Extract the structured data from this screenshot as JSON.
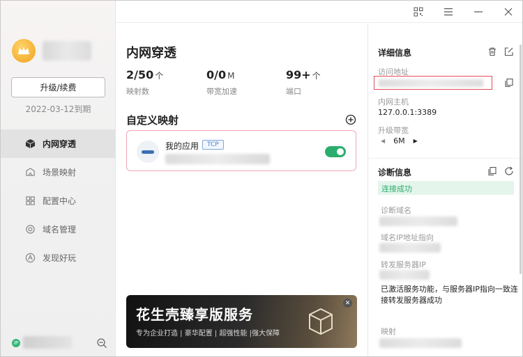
{
  "sidebar": {
    "upgrade_label": "升级/续费",
    "expire_text": "2022-03-12到期",
    "items": [
      {
        "label": "内网穿透",
        "icon": "cube-icon",
        "active": true
      },
      {
        "label": "场景映射",
        "icon": "scene-icon",
        "active": false
      },
      {
        "label": "配置中心",
        "icon": "config-icon",
        "active": false
      },
      {
        "label": "域名管理",
        "icon": "domain-icon",
        "active": false
      },
      {
        "label": "发现好玩",
        "icon": "discover-icon",
        "active": false
      }
    ],
    "ip_badge": "IP"
  },
  "main": {
    "title": "内网穿透",
    "stats": [
      {
        "value": "2/50",
        "unit": "个",
        "label": "映射数"
      },
      {
        "value": "0/0",
        "unit": "M",
        "label": "带宽加速"
      },
      {
        "value": "99+",
        "unit": "个",
        "label": "端口"
      }
    ],
    "custom_section_title": "自定义映射",
    "mapping": {
      "name": "我的应用",
      "protocol": "TCP",
      "enabled": true
    },
    "banner": {
      "title": "花生壳臻享版服务",
      "subtitle": "专为企业打造 | 豪华配置 | 超强性能 |强大保障",
      "close": "✕"
    }
  },
  "detail": {
    "title": "详细信息",
    "access_label": "访问地址",
    "host_label": "内网主机",
    "host_value": "127.0.0.1:3389",
    "bandwidth_label": "升级带宽",
    "bandwidth_value": "6M"
  },
  "diagnosis": {
    "title": "诊断信息",
    "status": "连接成功",
    "domain_label": "诊断域名",
    "ip_label": "域名IP地址指向",
    "server_label": "转发服务器IP",
    "note": "已激活服务功能，与服务器IP指向一致连接转发服务器成功",
    "mapping_label": "映射"
  },
  "colors": {
    "accent_green": "#2bad6d",
    "alert_red": "#e34c5a",
    "card_border": "#f2a5b4"
  }
}
